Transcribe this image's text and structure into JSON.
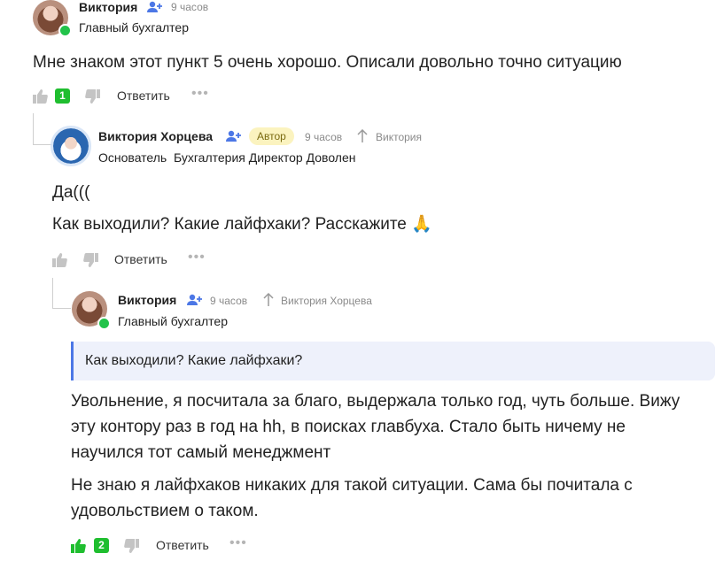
{
  "comment1": {
    "author": "Виктория",
    "time": "9 часов",
    "role": "Главный бухгалтер",
    "text": "Мне знаком этот пункт 5 очень хорошо. Описали довольно точно ситуацию",
    "likes": "1",
    "reply_label": "Ответить",
    "more": "•••"
  },
  "comment2": {
    "author": "Виктория Хорцева",
    "badge": "Автор",
    "time": "9 часов",
    "reply_to": "Виктория",
    "roles": "Основатель  Бухгалтерия Директор Доволен",
    "text_line1": "Да(((",
    "text_line2": "Как выходили? Какие лайфхаки? Расскажите 🙏",
    "reply_label": "Ответить",
    "more": "•••"
  },
  "comment3": {
    "author": "Виктория",
    "time": "9 часов",
    "reply_to": "Виктория Хорцева",
    "role": "Главный бухгалтер",
    "quote": "Как выходили? Какие лайфхаки?",
    "para1": [
      "Увольнение, я посчитала за благо, выдержала только год, чуть больше. Вижу",
      "эту контору раз в год на hh, в поисках главбуха. Стало быть ничему не",
      "научился тот самый менеджмент"
    ],
    "para2": [
      "Не знаю я лайфхаков никаких для такой ситуации. Сама бы почитала с",
      "удовольствием о таком."
    ],
    "likes": "2",
    "reply_label": "Ответить",
    "more": "•••"
  },
  "colors": {
    "accent": "#4c77e6",
    "like_green": "#1fbe2f",
    "online": "#22c34a",
    "author_badge_bg": "#fbf3bf"
  }
}
